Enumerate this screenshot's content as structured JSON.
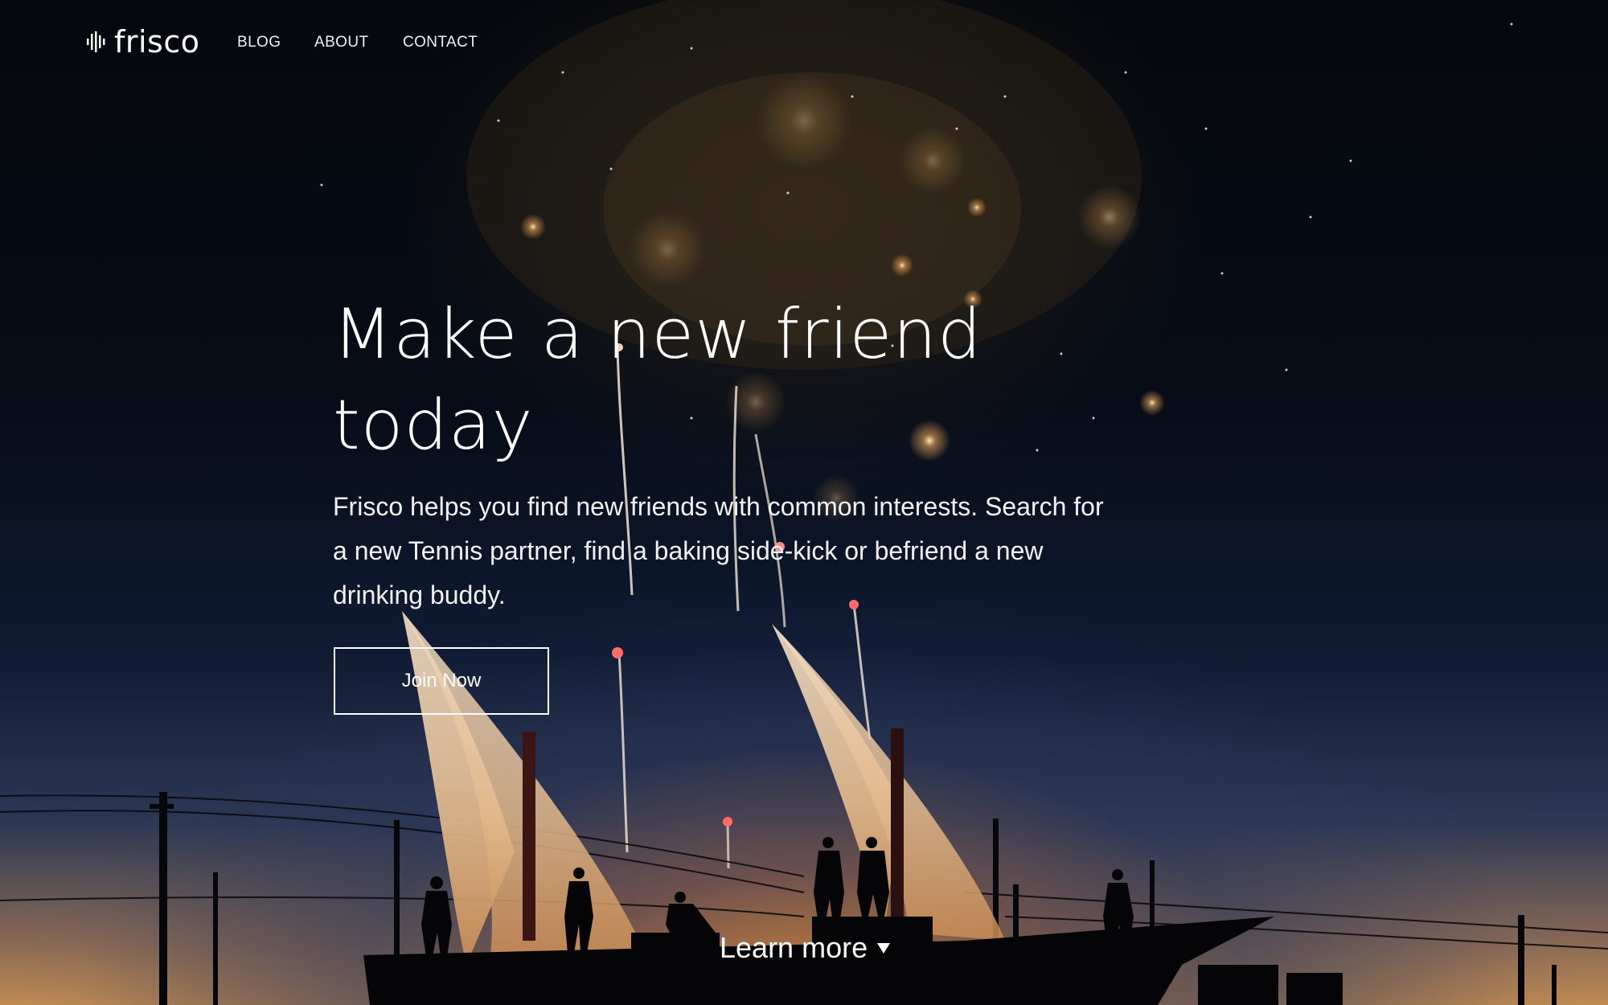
{
  "brand": {
    "name": "frisco",
    "logo_icon": "sound-wave-icon"
  },
  "nav": {
    "items": [
      "BLOG",
      "ABOUT",
      "CONTACT"
    ]
  },
  "hero": {
    "headline": "Make a new friend today",
    "subtext": "Frisco helps you find new friends with common interests. Search for a new Tennis partner, find a baking side-kick or befriend a new drinking buddy.",
    "cta_label": "Join Now",
    "learn_more_label": "Learn more",
    "learn_more_icon": "triangle-down-icon"
  },
  "colors": {
    "text": "#ffffff",
    "night_sky": "#05080d",
    "horizon_glow": "#c08a52"
  }
}
